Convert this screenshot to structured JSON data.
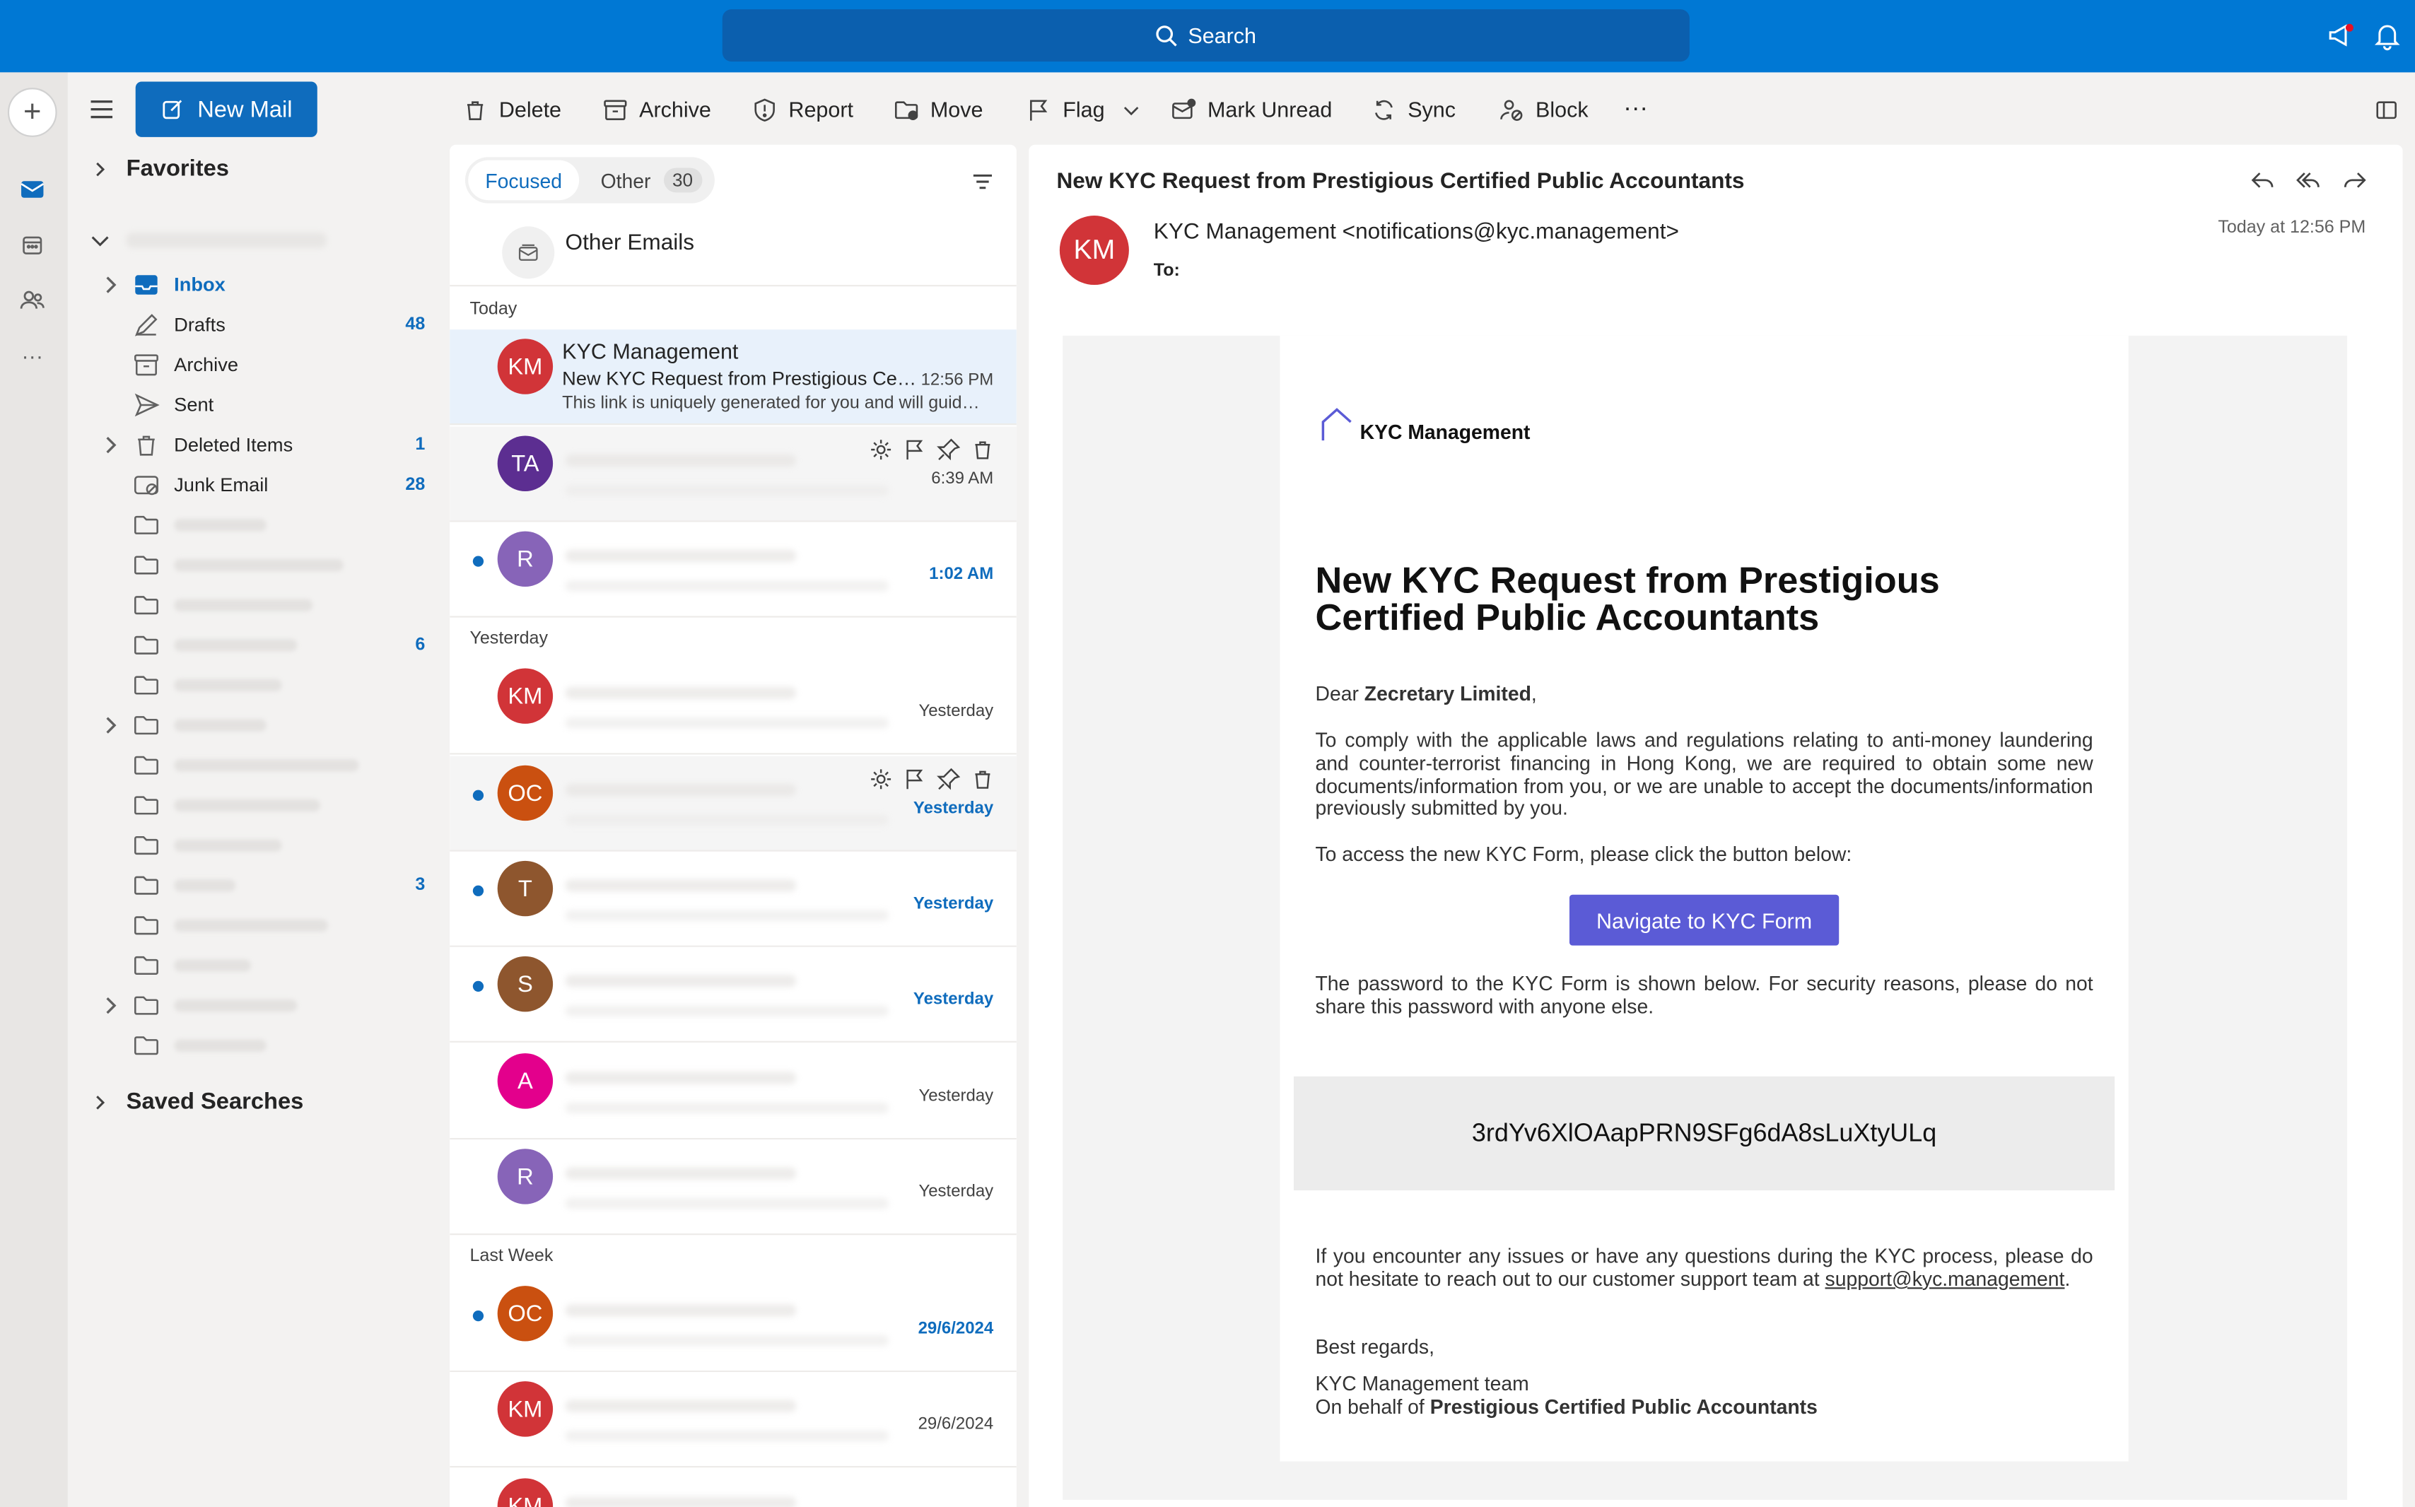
{
  "topbar": {
    "search_label": "Search"
  },
  "compose": {
    "new_mail_label": "New Mail"
  },
  "folders": {
    "favorites_label": "Favorites",
    "saved_searches_label": "Saved Searches",
    "items": [
      {
        "label": "Inbox",
        "count": "",
        "icon": "inbox-icon"
      },
      {
        "label": "Drafts",
        "count": "48",
        "icon": "drafts-icon"
      },
      {
        "label": "Archive",
        "count": "",
        "icon": "archive-icon"
      },
      {
        "label": "Sent",
        "count": "",
        "icon": "sent-icon"
      },
      {
        "label": "Deleted Items",
        "count": "1",
        "icon": "trash-icon"
      },
      {
        "label": "Junk Email",
        "count": "28",
        "icon": "junk-icon"
      }
    ],
    "extra_counts": [
      "6",
      "3"
    ]
  },
  "toolbar": {
    "delete": "Delete",
    "archive": "Archive",
    "report": "Report",
    "move": "Move",
    "flag": "Flag",
    "mark_unread": "Mark Unread",
    "sync": "Sync",
    "block": "Block",
    "more": "···"
  },
  "list": {
    "tab_focused": "Focused",
    "tab_other": "Other",
    "other_count": "30",
    "other_emails_label": "Other Emails",
    "group_today": "Today",
    "group_yesterday": "Yesterday",
    "group_last_week": "Last Week",
    "messages": [
      {
        "initials": "KM",
        "color": "#d13438",
        "sender": "KYC Management",
        "subject": "New KYC Request from Prestigious Certified Public Accountants",
        "preview": "This link is uniquely generated for you and will guide you through the process",
        "time": "12:56 PM",
        "unread": false
      },
      {
        "initials": "TA",
        "color": "#5c2e91",
        "time": "6:39 AM",
        "unread": false
      },
      {
        "initials": "R",
        "color": "#8764b8",
        "time": "1:02 AM",
        "unread": true
      },
      {
        "initials": "KM",
        "color": "#d13438",
        "time": "Yesterday",
        "unread": false
      },
      {
        "initials": "OC",
        "color": "#ca5010",
        "time": "Yesterday",
        "unread": true
      },
      {
        "initials": "T",
        "color": "#8e562e",
        "time": "Yesterday",
        "unread": true
      },
      {
        "initials": "S",
        "color": "#8e562e",
        "time": "Yesterday",
        "unread": true
      },
      {
        "initials": "A",
        "color": "#e3008c",
        "time": "Yesterday",
        "unread": false
      },
      {
        "initials": "R",
        "color": "#8764b8",
        "time": "Yesterday",
        "unread": false
      },
      {
        "initials": "OC",
        "color": "#ca5010",
        "time": "29/6/2024",
        "unread": true
      },
      {
        "initials": "KM",
        "color": "#d13438",
        "time": "29/6/2024",
        "unread": false
      },
      {
        "initials": "KM",
        "color": "#d13438",
        "time": "",
        "unread": false
      }
    ]
  },
  "reading": {
    "subject": "New KYC Request from Prestigious Certified Public Accountants",
    "avatar_initials": "KM",
    "from": "KYC Management <notifications@kyc.management>",
    "to_label": "To:",
    "date": "Today at 12:56 PM",
    "body": {
      "logo_text": "KYC Management",
      "heading": "New KYC Request from Prestigious Certified Public Accountants",
      "dear": "Dear ",
      "recipient": "Zecretary Limited",
      "dear_suffix": ",",
      "para1": "To comply with the applicable laws and regulations relating to anti-money laundering and counter-terrorist financing in Hong Kong, we are required to obtain some new documents/information from you, or we are unable to accept the documents/information previously submitted by you.",
      "para2": "To access the new KYC Form, please click the button below:",
      "button": "Navigate to KYC Form",
      "para3": "The password to the KYC Form is shown below. For security reasons, please do not share this password with anyone else.",
      "password": "3rdYv6XlOAapPRN9SFg6dA8sLuXtyULq",
      "para4": "If you encounter any issues or have any questions during the KYC process, please do not hesitate to reach out to our customer support team at ",
      "support_email": "support@kyc.management",
      "para4_end": ".",
      "regards": "Best regards,",
      "team": "KYC Management team",
      "behalf_prefix": "On behalf of ",
      "behalf_org": "Prestigious Certified Public Accountants"
    }
  },
  "colors": {
    "brand": "#0078d4",
    "accent": "#0f6cbd",
    "cta": "#5b5bd6"
  }
}
